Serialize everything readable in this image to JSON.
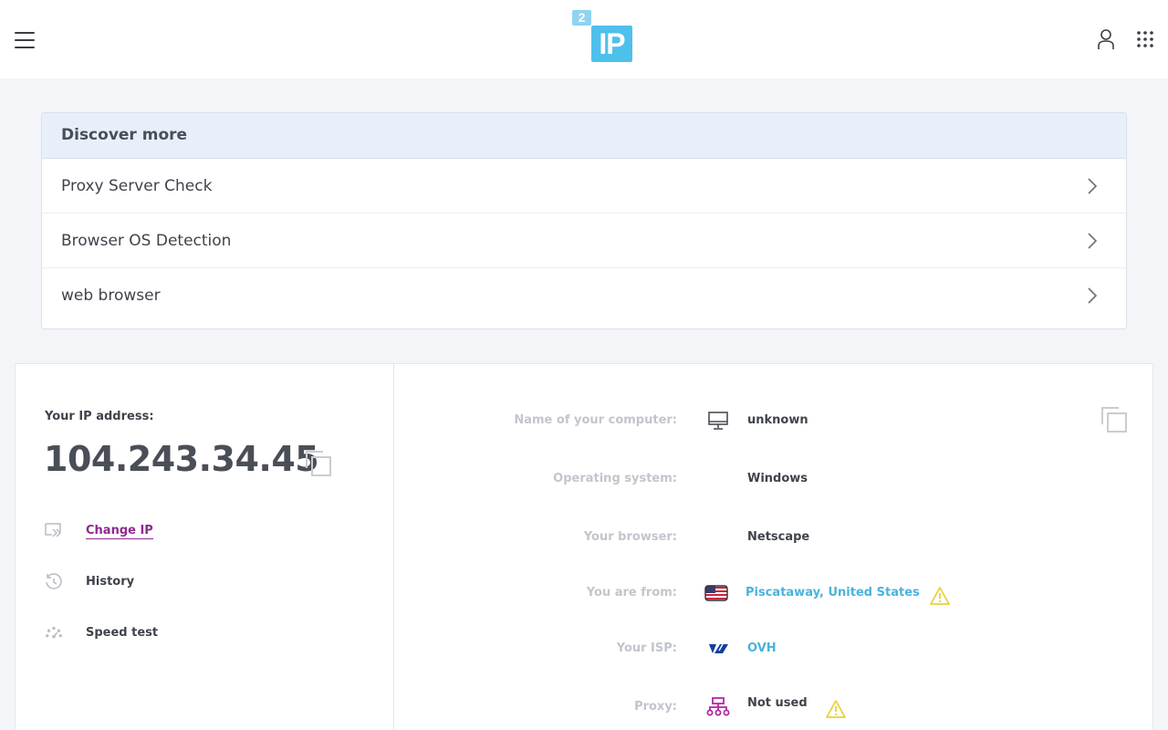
{
  "header": {
    "logo_small": "2",
    "logo_big": "IP"
  },
  "discover": {
    "title": "Discover more",
    "items": [
      {
        "label": "Proxy Server Check"
      },
      {
        "label": "Browser OS Detection"
      },
      {
        "label": "web browser"
      }
    ]
  },
  "ip_panel": {
    "label": "Your IP address:",
    "ip": "104.243.34.45",
    "actions": [
      {
        "label": "Change IP",
        "icon": "change-ip-icon"
      },
      {
        "label": "History",
        "icon": "history-icon"
      },
      {
        "label": "Speed test",
        "icon": "speedometer-icon"
      }
    ]
  },
  "details": {
    "computer_name": {
      "label": "Name of your computer:",
      "value": "unknown",
      "icon": "monitor-icon"
    },
    "os": {
      "label": "Operating system:",
      "value": "Windows"
    },
    "browser": {
      "label": "Your browser:",
      "value": "Netscape"
    },
    "location": {
      "label": "You are from:",
      "value": "Piscataway, United States",
      "icon": "us-flag-icon"
    },
    "isp": {
      "label": "Your ISP:",
      "value": "OVH",
      "icon": "ovh-logo-icon"
    },
    "proxy": {
      "label": "Proxy:",
      "value": "Not used",
      "icon": "proxy-network-icon"
    }
  },
  "colors": {
    "accent": "#4ec0ec",
    "link": "#4ab3dc",
    "change_ip": "#8e2a8f",
    "warning": "#e6d23a",
    "proxy_icon": "#b0289f"
  }
}
